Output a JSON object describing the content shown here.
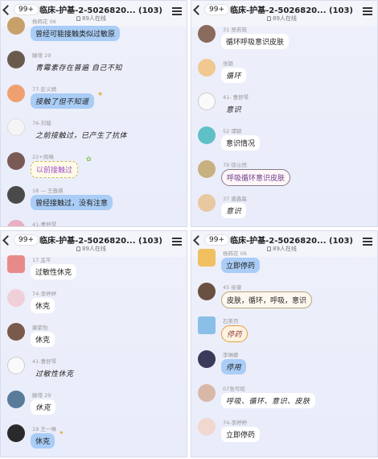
{
  "header": {
    "back_badge": "99+",
    "title": "临床-护基-2-5026820... (103)",
    "online": "89人在线"
  },
  "panels": [
    {
      "messages": [
        {
          "name": "杨韩花 06",
          "text": "曾经可能接触类似过敏原"
        },
        {
          "name": "滕增 29",
          "text": "青霉素存在普遍 自己不知"
        },
        {
          "name": "77-彭义婧",
          "text": "接触了但不知道"
        },
        {
          "name": "76-刘璇",
          "text": "之前接触过，已产生了抗体"
        },
        {
          "name": "22+周琳",
          "text": "以前接触过"
        },
        {
          "name": "18 — 王傲瑛",
          "text": "曾经接触过，没有注意"
        },
        {
          "name": "41-曹舒琴",
          "text": ""
        }
      ]
    },
    {
      "messages": [
        {
          "name": "31 吴若萌",
          "text": "循环呼吸意识皮肤"
        },
        {
          "name": "张颖",
          "text": "循环"
        },
        {
          "name": "41- 曹舒琴",
          "text": "意识"
        },
        {
          "name": "52 谭颖",
          "text": "意识情况"
        },
        {
          "name": "79 徐沁悦",
          "text": "呼吸循环意识皮肤"
        },
        {
          "name": "37 唐鑫磊",
          "text": "意识"
        }
      ]
    },
    {
      "messages": [
        {
          "name": "17 孟平",
          "text": "过敏性休克"
        },
        {
          "name": "74-李婷婷",
          "text": "休克"
        },
        {
          "name": "康紫怡",
          "text": "休克"
        },
        {
          "name": "41-曹舒琴",
          "text": "过敏性休克"
        },
        {
          "name": "滕增 29",
          "text": "休克"
        },
        {
          "name": "19 王一琳",
          "text": "休克"
        }
      ]
    },
    {
      "messages": [
        {
          "name": "杨韩花 06",
          "text": "立即停药"
        },
        {
          "name": "45 侯睿",
          "text": "皮肤，循环，呼吸，意识"
        },
        {
          "name": "石美月",
          "text": "停药"
        },
        {
          "name": "李琳娜",
          "text": "停用"
        },
        {
          "name": "07张可昭",
          "text": "呼吸、循环、意识、皮肤"
        },
        {
          "name": "74-李婷婷",
          "text": "立即停药"
        }
      ]
    }
  ]
}
